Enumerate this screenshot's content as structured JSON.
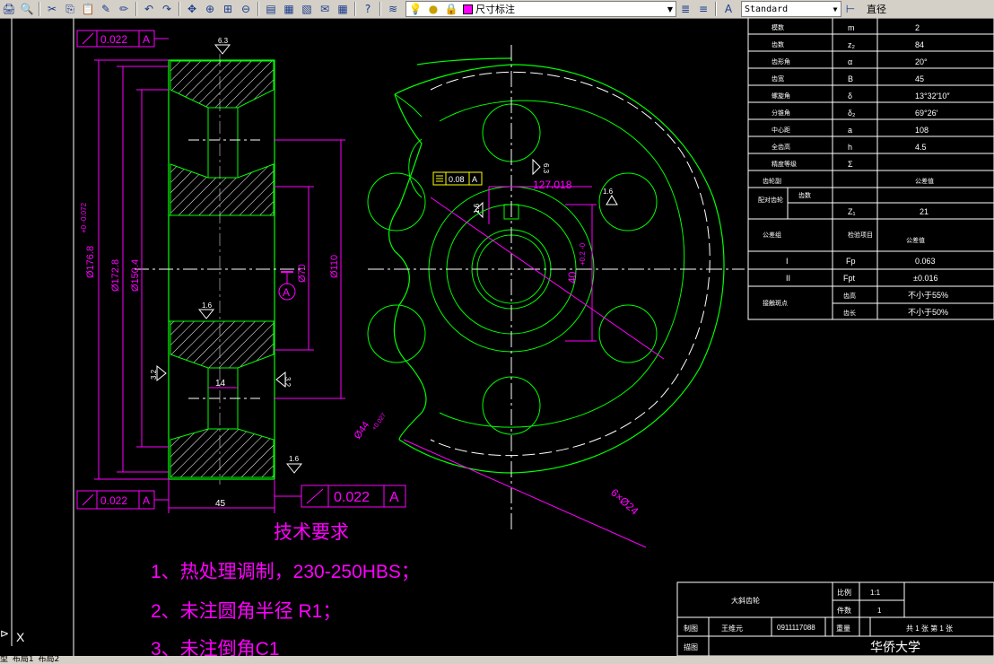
{
  "toolbar": {
    "layer_name": "尺寸标注",
    "text_style": "Standard",
    "right_label": "直径"
  },
  "tabs": {
    "prefix": "型",
    "layout1": "布局1",
    "layout2": "布局2"
  },
  "drawing": {
    "gdt_1": "0.022",
    "gdt_datum": "A",
    "gdt_2": "0.022",
    "gdt_3": "0.022",
    "sym_gdt": "0.08",
    "rough_63": "6.3",
    "rough_16a": "1.6",
    "rough_32a": "3.2",
    "rough_32b": "3.2",
    "rough_16b": "1.6",
    "rough_16c": "1.6",
    "rough_63b": "6.3",
    "rough_16d": "1.6",
    "rough_32c": "3.2",
    "dim_o176": "Ø176.8",
    "dim_o176_tol": "+0 -0.072",
    "dim_o172": "Ø172.8",
    "dim_o150": "Ø150.4",
    "dim_o70": "Ø70",
    "dim_o110": "Ø110",
    "dim_14": "14",
    "dim_45": "45",
    "datum_A": "A",
    "dim_127": "127.018",
    "dim_44": "Ø44",
    "dim_44_tol": "+0.027",
    "dim_40": "40",
    "dim_40_tol": "+0.2 -0",
    "dim_holes": "6×Ø24",
    "tech_title": "技术要求",
    "tech_1": "1、热处理调制，230-250HBS；",
    "tech_2": "2、未注圆角半径 R1；",
    "tech_3": "3、未注倒角C1"
  },
  "params": [
    {
      "name": "模数",
      "sym": "m",
      "val": "2"
    },
    {
      "name": "齿数",
      "sym": "z₂",
      "val": "84"
    },
    {
      "name": "齿形角",
      "sym": "α",
      "val": "20°"
    },
    {
      "name": "齿宽",
      "sym": "B",
      "val": "45"
    },
    {
      "name": "螺旋角",
      "sym": "δ",
      "val": "13°32′10″"
    },
    {
      "name": "分锥角",
      "sym": "δ₂",
      "val": "69°26′"
    },
    {
      "name": "中心距",
      "sym": "a",
      "val": "108"
    },
    {
      "name": "全齿高",
      "sym": "h",
      "val": "4.5"
    },
    {
      "name": "精度等级",
      "sym": "Σ",
      "val": ""
    }
  ],
  "params2": {
    "row10": "齿轮副",
    "pair_name": "配对齿轮",
    "pair_sub": "齿数",
    "z1_sym": "Z₁",
    "z1_val": "21",
    "tol_group": "公差组",
    "tol_sub": "检验项目",
    "tol_val": "公差值",
    "fp_sym": "Fp",
    "fp_val": "0.063",
    "fpt_sym": "Fpt",
    "fpt_val": "±0.016",
    "contact_label": "接触斑点",
    "contact_h": "齿高",
    "contact_h_val": "不小于55%",
    "contact_l": "齿长",
    "contact_l_val": "不小于50%",
    "row_I": "I",
    "row_II": "II"
  },
  "title_block": {
    "part_name": "大斜齿轮",
    "scale_label": "比例",
    "scale_val": "1:1",
    "qty_label": "件数",
    "qty_val": "1",
    "drawn_label": "制图",
    "drawn_name": "王维元",
    "drawn_no": "0911117088",
    "weight_label": "重量",
    "sheets": "共 1 张  第 1 张",
    "check_label": "描图",
    "school": "华侨大学"
  },
  "colors": {
    "bg": "#000000",
    "green": "#00ff00",
    "magenta": "#ff00ff",
    "white": "#ffffff",
    "yellow": "#ffff00"
  }
}
